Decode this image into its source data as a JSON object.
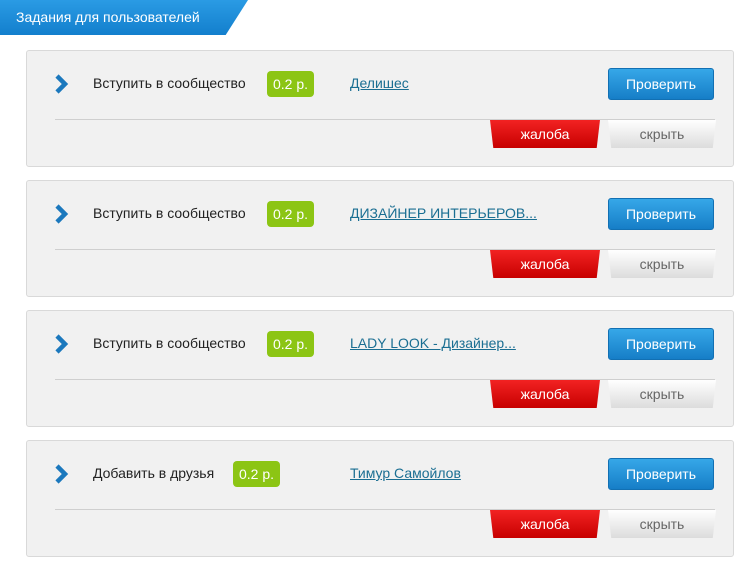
{
  "header": {
    "title": "Задания для пользователей"
  },
  "colors": {
    "accent": "#1d8fd8",
    "price": "#8cc514",
    "report": "#e00000",
    "link": "#1a6e92"
  },
  "tasks": [
    {
      "action": "Вступить в сообщество",
      "price": "0.2 р.",
      "target": "Делишес",
      "check_label": "Проверить",
      "report_label": "жалоба",
      "hide_label": "скрыть"
    },
    {
      "action": "Вступить в сообщество",
      "price": "0.2 р.",
      "target": "ДИЗАЙНЕР ИНТЕРЬЕРОВ...",
      "check_label": "Проверить",
      "report_label": "жалоба",
      "hide_label": "скрыть"
    },
    {
      "action": "Вступить в сообщество",
      "price": "0.2 р.",
      "target": "LADY LOOK - Дизайнер...",
      "check_label": "Проверить",
      "report_label": "жалоба",
      "hide_label": "скрыть"
    },
    {
      "action": "Добавить в друзья",
      "price": "0.2 р.",
      "target": "Тимур Самойлов",
      "check_label": "Проверить",
      "report_label": "жалоба",
      "hide_label": "скрыть"
    }
  ],
  "icons": {
    "expand": "chevron-right-icon"
  }
}
